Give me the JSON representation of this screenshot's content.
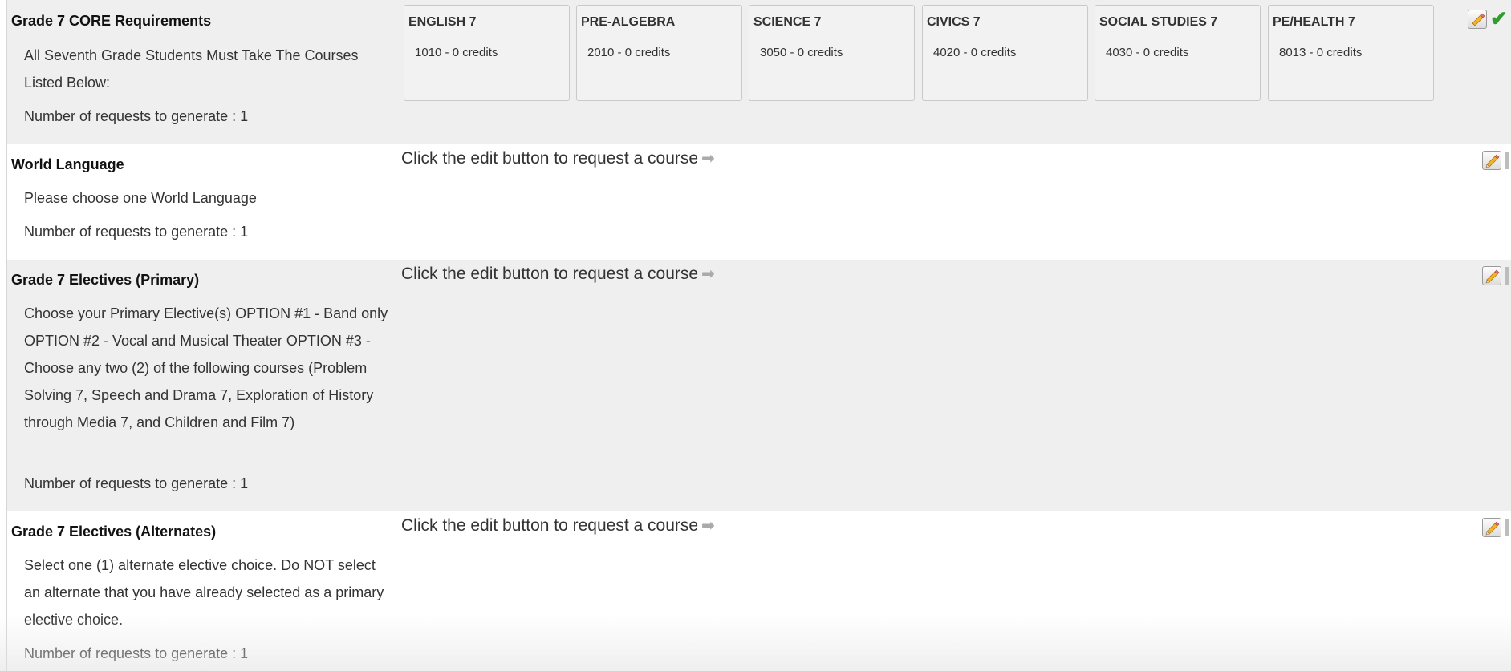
{
  "groups": [
    {
      "title": "Grade 7 CORE Requirements",
      "description": "All Seventh Grade Students Must Take The Courses Listed Below:",
      "requests": "Number of requests to generate : 1",
      "courses": [
        {
          "name": "ENGLISH 7",
          "code": "1010 - 0 credits"
        },
        {
          "name": "PRE-ALGEBRA",
          "code": "2010 - 0 credits"
        },
        {
          "name": "SCIENCE 7",
          "code": "3050 - 0 credits"
        },
        {
          "name": "CIVICS 7",
          "code": "4020 - 0 credits"
        },
        {
          "name": "SOCIAL STUDIES 7",
          "code": "4030 - 0 credits"
        },
        {
          "name": "PE/HEALTH 7",
          "code": "8013 - 0 credits"
        }
      ],
      "complete_icon": "check-icon"
    },
    {
      "title": "World Language",
      "description": "Please choose one World Language",
      "requests": "Number of requests to generate : 1",
      "prompt": "Click the edit button to request a course"
    },
    {
      "title": "Grade 7 Electives (Primary)",
      "description": "Choose your Primary Elective(s) OPTION #1 - Band only OPTION #2 - Vocal and Musical Theater OPTION #3 - Choose any two (2) of the following courses (Problem Solving 7, Speech and Drama 7, Exploration of History through Media 7, and Children and Film 7)",
      "requests": "Number of requests to generate : 1",
      "prompt": "Click the edit button to request a course"
    },
    {
      "title": "Grade 7 Electives (Alternates)",
      "description": "Select one (1) alternate elective choice. Do NOT select an alternate that you have already selected as a primary elective choice.",
      "requests": "Number of requests to generate : 1",
      "prompt": "Click the edit button to request a course"
    }
  ],
  "icons": {
    "edit": "pencil-icon",
    "arrow": "right-arrow-icon",
    "complete": "check-icon"
  },
  "colors": {
    "row_shaded": "#efefef",
    "row_plain": "#ffffff",
    "check": "#2f9e2f",
    "pencil": "#f0b429"
  }
}
